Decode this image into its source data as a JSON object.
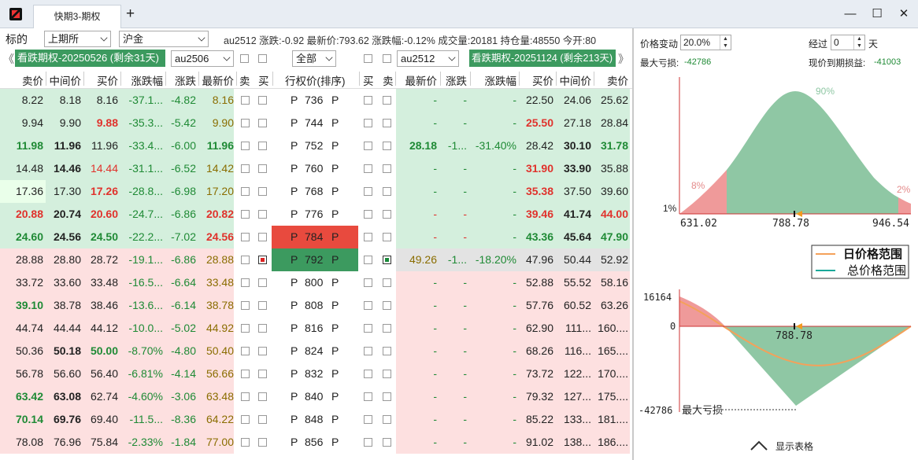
{
  "window": {
    "tab_title": "快期3-期权",
    "add_tab": "+",
    "min": "—",
    "max": "☐",
    "close": "✕"
  },
  "toolbar": {
    "underlying_label": "标的",
    "exchange": "上期所",
    "product": "沪金",
    "quote_text": "au2512 涨跌:-0.92 最新价:793.62 涨跌幅:-0.12% 成交量:20181 持仓量:48550 今开:80",
    "left_series": "看跌期权-20250526 (剩余31天)",
    "left_contract": "au2506",
    "filter": "全部",
    "right_contract": "au2512",
    "right_series": "看跌期权-20251124 (剩余213天)",
    "nav_prev": "《",
    "nav_next": "》"
  },
  "headers": {
    "left": [
      "卖价",
      "中间价",
      "买价",
      "涨跌幅",
      "涨跌",
      "最新价",
      "卖",
      "买"
    ],
    "strike": "行权价(排序)",
    "right": [
      "买",
      "卖",
      "最新价",
      "涨跌",
      "涨跌幅",
      "买价",
      "中间价",
      "卖价"
    ]
  },
  "rows": [
    {
      "l": [
        "8.22",
        "8.18",
        "8.16",
        "-37.1...",
        "-4.82",
        "8.16"
      ],
      "lc": [
        "",
        "",
        "",
        "grn",
        "grn",
        "gold"
      ],
      "lb": [
        0,
        0,
        0,
        0,
        0,
        0
      ],
      "lbg": "#d4efdd",
      "strike": "736",
      "r": [
        "-",
        "-",
        "-",
        "22.50",
        "24.06",
        "25.62"
      ],
      "rc": [
        "grn",
        "grn",
        "grn",
        "",
        "",
        ""
      ],
      "rb": [
        0,
        0,
        0,
        0,
        0,
        0
      ],
      "rbg": "#d4efdd"
    },
    {
      "l": [
        "9.94",
        "9.90",
        "9.88",
        "-35.3...",
        "-5.42",
        "9.90"
      ],
      "lc": [
        "",
        "",
        "red",
        "grn",
        "grn",
        "gold"
      ],
      "lb": [
        0,
        0,
        1,
        0,
        0,
        0
      ],
      "lbg": "#d4efdd",
      "strike": "744",
      "r": [
        "-",
        "-",
        "-",
        "25.50",
        "27.18",
        "28.84"
      ],
      "rc": [
        "grn",
        "grn",
        "grn",
        "red",
        "",
        ""
      ],
      "rb": [
        0,
        0,
        0,
        1,
        0,
        0
      ],
      "rbg": "#d4efdd"
    },
    {
      "l": [
        "11.98",
        "11.96",
        "11.96",
        "-33.4...",
        "-6.00",
        "11.96"
      ],
      "lc": [
        "grn",
        "",
        "",
        "grn",
        "grn",
        "grn"
      ],
      "lb": [
        1,
        1,
        0,
        0,
        0,
        1
      ],
      "lbg": "#d4efdd",
      "strike": "752",
      "r": [
        "28.18",
        "-1...",
        "-31.40%",
        "28.42",
        "30.10",
        "31.78"
      ],
      "rc": [
        "grn",
        "grn",
        "grn",
        "",
        "",
        "grn"
      ],
      "rb": [
        1,
        0,
        0,
        0,
        1,
        1
      ],
      "rbg": "#d4efdd"
    },
    {
      "l": [
        "14.48",
        "14.46",
        "14.44",
        "-31.1...",
        "-6.52",
        "14.42"
      ],
      "lc": [
        "",
        "",
        "red",
        "grn",
        "grn",
        "gold"
      ],
      "lb": [
        0,
        1,
        0,
        0,
        0,
        0
      ],
      "lbg": "#d4efdd",
      "strike": "760",
      "r": [
        "-",
        "-",
        "-",
        "31.90",
        "33.90",
        "35.88"
      ],
      "rc": [
        "grn",
        "grn",
        "grn",
        "red",
        "",
        ""
      ],
      "rb": [
        0,
        0,
        0,
        1,
        1,
        0
      ],
      "rbg": "#d4efdd"
    },
    {
      "l": [
        "17.36",
        "17.30",
        "17.26",
        "-28.8...",
        "-6.98",
        "17.20"
      ],
      "lc": [
        "",
        "",
        "red",
        "grn",
        "grn",
        "gold"
      ],
      "lb": [
        0,
        0,
        1,
        0,
        0,
        0
      ],
      "lbg": "#d4efdd",
      "strike": "768",
      "r": [
        "-",
        "-",
        "-",
        "35.38",
        "37.50",
        "39.60"
      ],
      "rc": [
        "grn",
        "grn",
        "grn",
        "red",
        "",
        ""
      ],
      "rb": [
        0,
        0,
        0,
        1,
        0,
        0
      ],
      "rbg": "#d4efdd"
    },
    {
      "l": [
        "20.88",
        "20.74",
        "20.60",
        "-24.7...",
        "-6.86",
        "20.82"
      ],
      "lc": [
        "red",
        "",
        "red",
        "grn",
        "grn",
        "red"
      ],
      "lb": [
        1,
        1,
        1,
        0,
        0,
        1
      ],
      "lbg": "#d4efdd",
      "strike": "776",
      "r": [
        "-",
        "-",
        "-",
        "39.46",
        "41.74",
        "44.00"
      ],
      "rc": [
        "red",
        "red",
        "grn",
        "red",
        "",
        "red"
      ],
      "rb": [
        0,
        0,
        0,
        1,
        1,
        1
      ],
      "rbg": "#d4efdd"
    },
    {
      "l": [
        "24.60",
        "24.56",
        "24.50",
        "-22.2...",
        "-7.02",
        "24.56"
      ],
      "lc": [
        "grn",
        "",
        "grn",
        "grn",
        "grn",
        "red"
      ],
      "lb": [
        1,
        1,
        1,
        0,
        0,
        1
      ],
      "lbg": "#d4efdd",
      "strike": "784",
      "r": [
        "-",
        "-",
        "-",
        "43.36",
        "45.64",
        "47.90"
      ],
      "rc": [
        "red",
        "red",
        "grn",
        "grn",
        "",
        "grn"
      ],
      "rb": [
        0,
        0,
        0,
        1,
        1,
        1
      ],
      "rbg": "#d4efdd"
    },
    {
      "l": [
        "28.88",
        "28.80",
        "28.72",
        "-19.1...",
        "-6.86",
        "28.88"
      ],
      "lc": [
        "",
        "",
        "",
        "grn",
        "grn",
        "gold"
      ],
      "lb": [
        0,
        0,
        0,
        0,
        0,
        0
      ],
      "lbg": "#fde0e0",
      "strike": "792",
      "r": [
        "49.26",
        "-1...",
        "-18.20%",
        "47.96",
        "50.44",
        "52.92"
      ],
      "rc": [
        "gold",
        "grn",
        "grn",
        "",
        "",
        ""
      ],
      "rb": [
        0,
        0,
        0,
        0,
        0,
        0
      ],
      "rbg": "#e3e3e3"
    },
    {
      "l": [
        "33.72",
        "33.60",
        "33.48",
        "-16.5...",
        "-6.64",
        "33.48"
      ],
      "lc": [
        "",
        "",
        "",
        "grn",
        "grn",
        "gold"
      ],
      "lb": [
        0,
        0,
        0,
        0,
        0,
        0
      ],
      "lbg": "#fde0e0",
      "strike": "800",
      "r": [
        "-",
        "-",
        "-",
        "52.88",
        "55.52",
        "58.16"
      ],
      "rc": [
        "grn",
        "grn",
        "grn",
        "",
        "",
        ""
      ],
      "rb": [
        0,
        0,
        0,
        0,
        0,
        0
      ],
      "rbg": "#fde0e0"
    },
    {
      "l": [
        "39.10",
        "38.78",
        "38.46",
        "-13.6...",
        "-6.14",
        "38.78"
      ],
      "lc": [
        "grn",
        "",
        "",
        "grn",
        "grn",
        "gold"
      ],
      "lb": [
        1,
        0,
        0,
        0,
        0,
        0
      ],
      "lbg": "#fde0e0",
      "strike": "808",
      "r": [
        "-",
        "-",
        "-",
        "57.76",
        "60.52",
        "63.26"
      ],
      "rc": [
        "grn",
        "grn",
        "grn",
        "",
        "",
        ""
      ],
      "rb": [
        0,
        0,
        0,
        0,
        0,
        0
      ],
      "rbg": "#fde0e0"
    },
    {
      "l": [
        "44.74",
        "44.44",
        "44.12",
        "-10.0...",
        "-5.02",
        "44.92"
      ],
      "lc": [
        "",
        "",
        "",
        "grn",
        "grn",
        "gold"
      ],
      "lb": [
        0,
        0,
        0,
        0,
        0,
        0
      ],
      "lbg": "#fde0e0",
      "strike": "816",
      "r": [
        "-",
        "-",
        "-",
        "62.90",
        "111...",
        "160...."
      ],
      "rc": [
        "grn",
        "grn",
        "grn",
        "",
        "",
        ""
      ],
      "rb": [
        0,
        0,
        0,
        0,
        0,
        0
      ],
      "rbg": "#fde0e0"
    },
    {
      "l": [
        "50.36",
        "50.18",
        "50.00",
        "-8.70%",
        "-4.80",
        "50.40"
      ],
      "lc": [
        "",
        "",
        "grn",
        "grn",
        "grn",
        "gold"
      ],
      "lb": [
        0,
        1,
        1,
        0,
        0,
        0
      ],
      "lbg": "#fde0e0",
      "strike": "824",
      "r": [
        "-",
        "-",
        "-",
        "68.26",
        "116...",
        "165...."
      ],
      "rc": [
        "grn",
        "grn",
        "grn",
        "",
        "",
        ""
      ],
      "rb": [
        0,
        0,
        0,
        0,
        0,
        0
      ],
      "rbg": "#fde0e0"
    },
    {
      "l": [
        "56.78",
        "56.60",
        "56.40",
        "-6.81%",
        "-4.14",
        "56.66"
      ],
      "lc": [
        "",
        "",
        "",
        "grn",
        "grn",
        "gold"
      ],
      "lb": [
        0,
        0,
        0,
        0,
        0,
        0
      ],
      "lbg": "#fde0e0",
      "strike": "832",
      "r": [
        "-",
        "-",
        "-",
        "73.72",
        "122...",
        "170...."
      ],
      "rc": [
        "grn",
        "grn",
        "grn",
        "",
        "",
        ""
      ],
      "rb": [
        0,
        0,
        0,
        0,
        0,
        0
      ],
      "rbg": "#fde0e0"
    },
    {
      "l": [
        "63.42",
        "63.08",
        "62.74",
        "-4.60%",
        "-3.06",
        "63.48"
      ],
      "lc": [
        "grn",
        "",
        "",
        "grn",
        "grn",
        "gold"
      ],
      "lb": [
        1,
        1,
        0,
        0,
        0,
        0
      ],
      "lbg": "#fde0e0",
      "strike": "840",
      "r": [
        "-",
        "-",
        "-",
        "79.32",
        "127...",
        "175...."
      ],
      "rc": [
        "grn",
        "grn",
        "grn",
        "",
        "",
        ""
      ],
      "rb": [
        0,
        0,
        0,
        0,
        0,
        0
      ],
      "rbg": "#fde0e0"
    },
    {
      "l": [
        "70.14",
        "69.76",
        "69.40",
        "-11.5...",
        "-8.36",
        "64.22"
      ],
      "lc": [
        "grn",
        "",
        "",
        "grn",
        "grn",
        "gold"
      ],
      "lb": [
        1,
        1,
        0,
        0,
        0,
        0
      ],
      "lbg": "#fde0e0",
      "strike": "848",
      "r": [
        "-",
        "-",
        "-",
        "85.22",
        "133...",
        "181...."
      ],
      "rc": [
        "grn",
        "grn",
        "grn",
        "",
        "",
        ""
      ],
      "rb": [
        0,
        0,
        0,
        0,
        0,
        0
      ],
      "rbg": "#fde0e0"
    },
    {
      "l": [
        "78.08",
        "76.96",
        "75.84",
        "-2.33%",
        "-1.84",
        "77.00"
      ],
      "lc": [
        "",
        "",
        "",
        "grn",
        "grn",
        "gold"
      ],
      "lb": [
        0,
        0,
        0,
        0,
        0,
        0
      ],
      "lbg": "#fde0e0",
      "strike": "856",
      "r": [
        "-",
        "-",
        "-",
        "91.02",
        "138...",
        "186...."
      ],
      "rc": [
        "grn",
        "grn",
        "grn",
        "",
        "",
        ""
      ],
      "rb": [
        0,
        0,
        0,
        0,
        0,
        0
      ],
      "rbg": "#fde0e0"
    }
  ],
  "type_letter": "P",
  "panel": {
    "price_change_label": "价格变动",
    "price_change_value": "20.0%",
    "days_label": "经过",
    "days_value": "0",
    "days_unit": "天",
    "max_loss_label": "最大亏损:",
    "max_loss_value": "-42786",
    "current_pnl_label": "现价到期损益:",
    "current_pnl_value": "-41003",
    "dist": {
      "x_min": "631.02",
      "x_mid": "788.78",
      "x_max": "946.54",
      "left_pct": "8%",
      "center_pct": "90%",
      "right_pct": "2%",
      "y_label": "1%"
    },
    "legend": [
      "日价格范围",
      "总价格范围"
    ],
    "pnl": {
      "y_max": "16164",
      "y_zero": "0",
      "y_min": "-42786",
      "min_label": "最大亏损",
      "price": "788.78"
    },
    "show_table": "显示表格",
    "colors": {
      "green_area": "#8fc7a4",
      "red_area": "#ef9a9a",
      "orange": "#f4a15a",
      "teal": "#1aa89a"
    }
  }
}
